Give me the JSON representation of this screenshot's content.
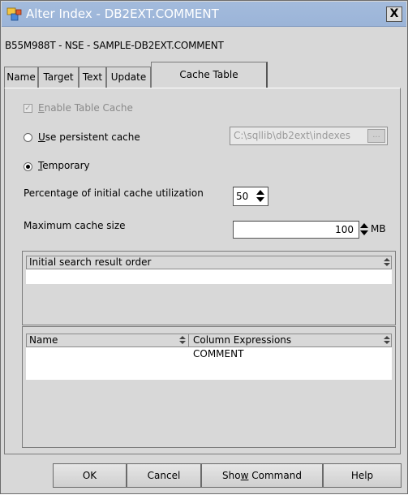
{
  "window": {
    "title": "Alter Index - DB2EXT.COMMENT",
    "close_glyph": "✕",
    "close_label": "X"
  },
  "subtitle": "B55M988T - NSE - SAMPLE-DB2EXT.COMMENT",
  "tabs": [
    {
      "label": "Name"
    },
    {
      "label": "Target"
    },
    {
      "label": "Text"
    },
    {
      "label": "Update"
    },
    {
      "label": "Cache Table",
      "active": true
    }
  ],
  "cache": {
    "enable_table_cache": {
      "label_mnemonic": "E",
      "label_rest": "nable Table Cache",
      "checked": true,
      "disabled": true
    },
    "use_persistent_cache": {
      "label_mnemonic": "U",
      "label_rest": "se persistent cache",
      "selected": false
    },
    "persistent_path": {
      "value": "C:\\sqllib\\db2ext\\indexes",
      "button_label": "..."
    },
    "temporary": {
      "label_mnemonic": "T",
      "label_rest": "emporary",
      "selected": true
    },
    "initial_utilization": {
      "label": "Percentage of initial cache utilization",
      "value": "50"
    },
    "max_cache_size": {
      "label": "Maximum cache size",
      "value": "100",
      "unit": "MB"
    }
  },
  "search_order_table": {
    "header": "Initial search result order"
  },
  "columns_table": {
    "headers": [
      "Name",
      "Column Expressions"
    ],
    "rows": [
      {
        "name": "",
        "expression": "COMMENT"
      }
    ]
  },
  "buttons": {
    "ok": "OK",
    "cancel": "Cancel",
    "show_command_before": "Sho",
    "show_command_mnemonic": "w",
    "show_command_after": " Command",
    "help": "Help"
  },
  "icons": {
    "app": "db2-index-icon",
    "close": "close-icon"
  }
}
